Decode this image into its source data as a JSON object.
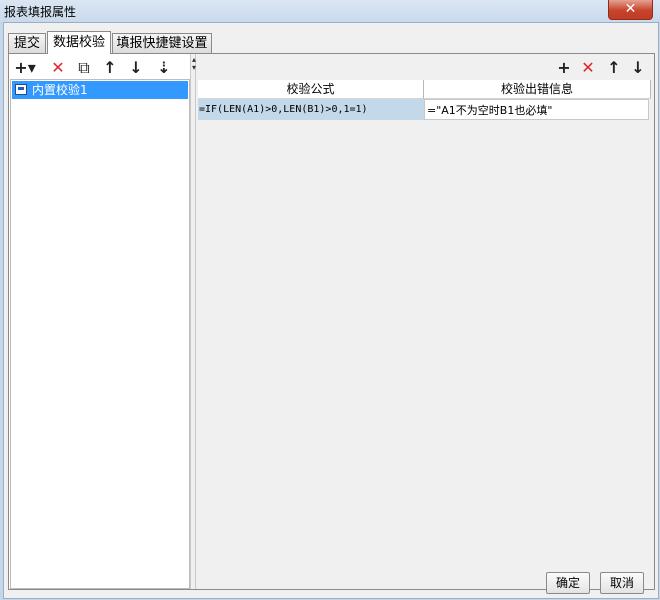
{
  "window": {
    "title": "报表填报属性",
    "close_glyph": "✕"
  },
  "tabs": [
    {
      "label": "提交"
    },
    {
      "label": "数据校验",
      "active": true
    },
    {
      "label": "填报快捷键设置"
    }
  ],
  "left_toolbar": {
    "add": "+▾",
    "delete": "✕",
    "copy": "⧉",
    "move_up": "↑",
    "move_down": "↓",
    "sort": "⇣"
  },
  "left_list": {
    "items": [
      {
        "label": "内置校验1",
        "selected": true
      }
    ]
  },
  "right_toolbar": {
    "add": "+",
    "delete": "✕",
    "move_up": "↑",
    "move_down": "↓"
  },
  "grid": {
    "columns": [
      "校验公式",
      "校验出错信息"
    ],
    "rows": [
      {
        "formula": "=IF(LEN(A1)>0,LEN(B1)>0,1=1)",
        "message": "=\"A1不为空时B1也必填\""
      }
    ]
  },
  "footer": {
    "ok_label": "确定",
    "cancel_label": "取消"
  },
  "colors": {
    "selection": "#3399ff",
    "delete_red": "#e0262a",
    "row_highlight": "#c3d9ea",
    "title_bg": "#c9d9ec"
  }
}
